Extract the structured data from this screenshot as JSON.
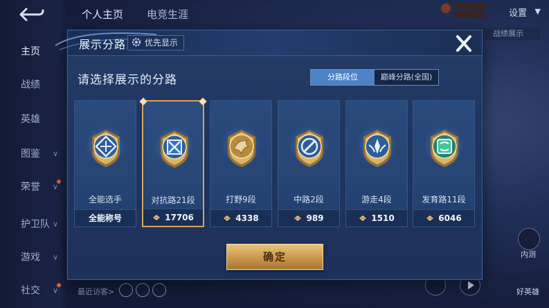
{
  "background": {
    "sidebar_items": [
      {
        "label": "主页",
        "active": true,
        "chevron": false,
        "dot": false
      },
      {
        "label": "战绩",
        "active": false,
        "chevron": false,
        "dot": false
      },
      {
        "label": "英雄",
        "active": false,
        "chevron": false,
        "dot": false
      },
      {
        "label": "图鉴",
        "active": false,
        "chevron": true,
        "dot": false
      },
      {
        "label": "荣誉",
        "active": false,
        "chevron": true,
        "dot": true
      },
      {
        "label": "护卫队",
        "active": false,
        "chevron": true,
        "dot": false
      },
      {
        "label": "游戏",
        "active": false,
        "chevron": true,
        "dot": false
      },
      {
        "label": "社交",
        "active": false,
        "chevron": true,
        "dot": true
      }
    ],
    "top_tabs": [
      "个人主页",
      "电竞生涯"
    ],
    "settings_label": "设置",
    "behind_tag": "战绩展示",
    "recent_visitors_label": "最近访客>",
    "right_labels": [
      "内测",
      "好英雄"
    ]
  },
  "modal": {
    "title": "展示分路",
    "priority_button": "优先显示",
    "prompt": "请选择展示的分路",
    "toggle": {
      "options": [
        "分路段位",
        "巅峰分路(全国)"
      ],
      "selected": 0
    },
    "cards": [
      {
        "name": "全能选手",
        "footer": "全能称号",
        "emblem": "allround-emblem-icon",
        "selected": false,
        "show_leaf": false
      },
      {
        "name": "对抗路21段",
        "footer": "17706",
        "emblem": "clash-lane-emblem-icon",
        "selected": true,
        "show_leaf": true
      },
      {
        "name": "打野9段",
        "footer": "4338",
        "emblem": "jungle-emblem-icon",
        "selected": false,
        "show_leaf": true
      },
      {
        "name": "中路2段",
        "footer": "989",
        "emblem": "mid-lane-emblem-icon",
        "selected": false,
        "show_leaf": true
      },
      {
        "name": "游走4段",
        "footer": "1510",
        "emblem": "roam-emblem-icon",
        "selected": false,
        "show_leaf": true
      },
      {
        "name": "发育路11段",
        "footer": "6046",
        "emblem": "farm-lane-emblem-icon",
        "selected": false,
        "show_leaf": true
      }
    ],
    "confirm_label": "确定"
  },
  "colors": {
    "accent_gold": "#d7a35a",
    "toggle_selected": "#4d83c6",
    "farm_lane_teal": "#3fc79a"
  }
}
